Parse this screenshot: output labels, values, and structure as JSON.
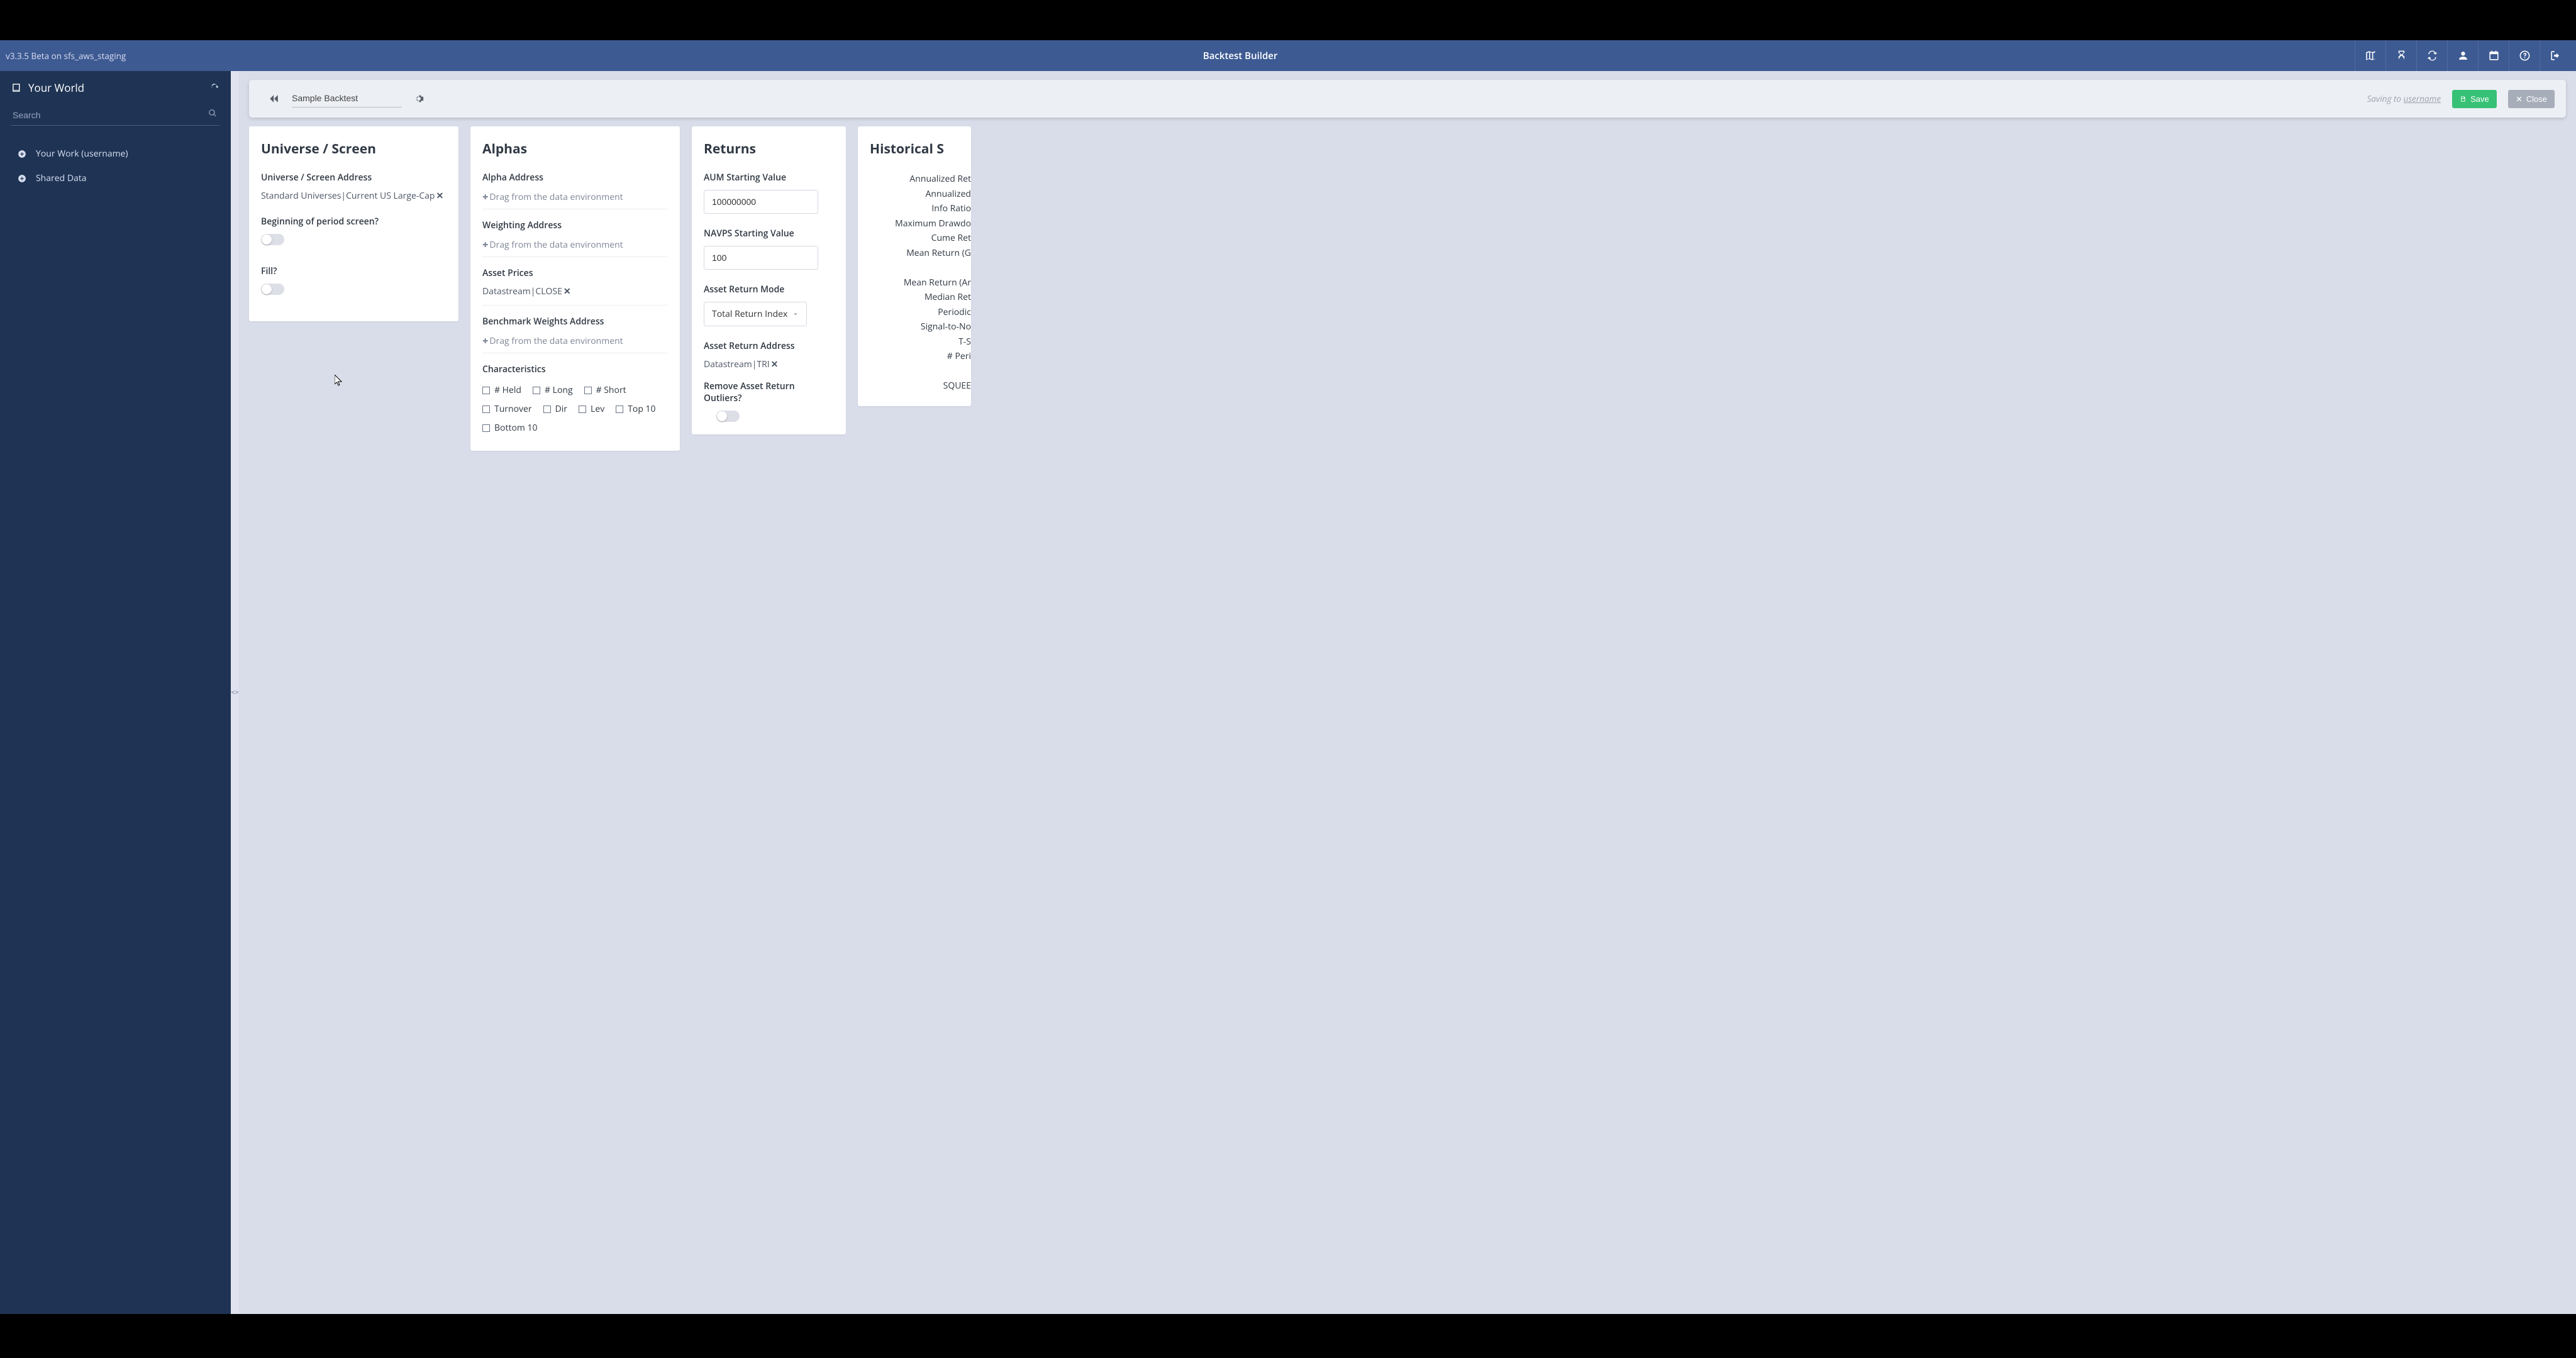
{
  "header": {
    "version": "v3.3.5 Beta on sfs_aws_staging",
    "title": "Backtest Builder"
  },
  "sidebar": {
    "title": "Your World",
    "search_placeholder": "Search",
    "items": [
      {
        "label": "Your Work (username)"
      },
      {
        "label": "Shared Data"
      }
    ]
  },
  "toolbar": {
    "backtest_name": "Sample Backtest",
    "saving_prefix": "Saving to ",
    "saving_user": "username",
    "save_label": "Save",
    "close_label": "Close"
  },
  "cards": {
    "universe": {
      "title": "Universe / Screen",
      "addr_label": "Universe / Screen Address",
      "addr_value": "Standard Universes|Current US Large-Cap",
      "beginning_label": "Beginning of period screen?",
      "fill_label": "Fill?"
    },
    "alphas": {
      "title": "Alphas",
      "alpha_addr_label": "Alpha Address",
      "drag_hint": "Drag from the data environment",
      "weight_addr_label": "Weighting Address",
      "asset_prices_label": "Asset Prices",
      "asset_prices_value": "Datastream|CLOSE",
      "bench_label": "Benchmark Weights Address",
      "char_label": "Characteristics",
      "char_items": [
        "# Held",
        "# Long",
        "# Short",
        "Turnover",
        "Dir",
        "Lev",
        "Top 10",
        "Bottom 10"
      ]
    },
    "returns": {
      "title": "Returns",
      "aum_label": "AUM Starting Value",
      "aum_value": "100000000",
      "navps_label": "NAVPS Starting Value",
      "navps_value": "100",
      "mode_label": "Asset Return Mode",
      "mode_value": "Total Return Index",
      "ret_addr_label": "Asset Return Address",
      "ret_addr_value": "Datastream|TRI",
      "outlier_label": "Remove Asset Return Outliers?"
    },
    "historical": {
      "title": "Historical S",
      "items": [
        "Annualized Ret",
        "Annualized",
        "Info Ratio",
        "Maximum Drawdo",
        "Cume Ret",
        "Mean Return (G",
        "",
        "Mean Return (Ar",
        "Median Ret",
        "Periodic",
        "Signal-to-No",
        "T-S",
        "# Peri",
        "",
        "SQUEE"
      ]
    }
  }
}
